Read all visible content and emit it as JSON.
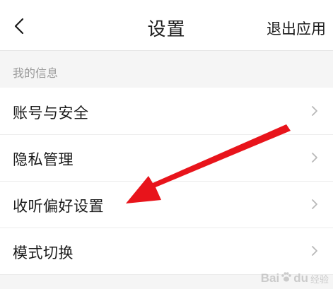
{
  "header": {
    "title": "设置",
    "exit_label": "退出应用",
    "back_icon": "chevron-left-icon"
  },
  "section": {
    "label": "我的信息"
  },
  "menu": {
    "items": [
      {
        "label": "账号与安全",
        "icon": "chevron-right-icon"
      },
      {
        "label": "隐私管理",
        "icon": "chevron-right-icon"
      },
      {
        "label": "收听偏好设置",
        "icon": "chevron-right-icon"
      },
      {
        "label": "模式切换",
        "icon": "chevron-right-icon"
      }
    ]
  },
  "annotation": {
    "color": "#e8141b",
    "points_to": "收听偏好设置"
  },
  "watermark": {
    "brand": "Bai",
    "brand_suffix": "du",
    "sub": "经验"
  },
  "colors": {
    "background": "#f5f5f5",
    "surface": "#ffffff",
    "text_primary": "#1a1a1a",
    "text_secondary": "#9a9a9a",
    "chevron": "#b8b8b8"
  }
}
